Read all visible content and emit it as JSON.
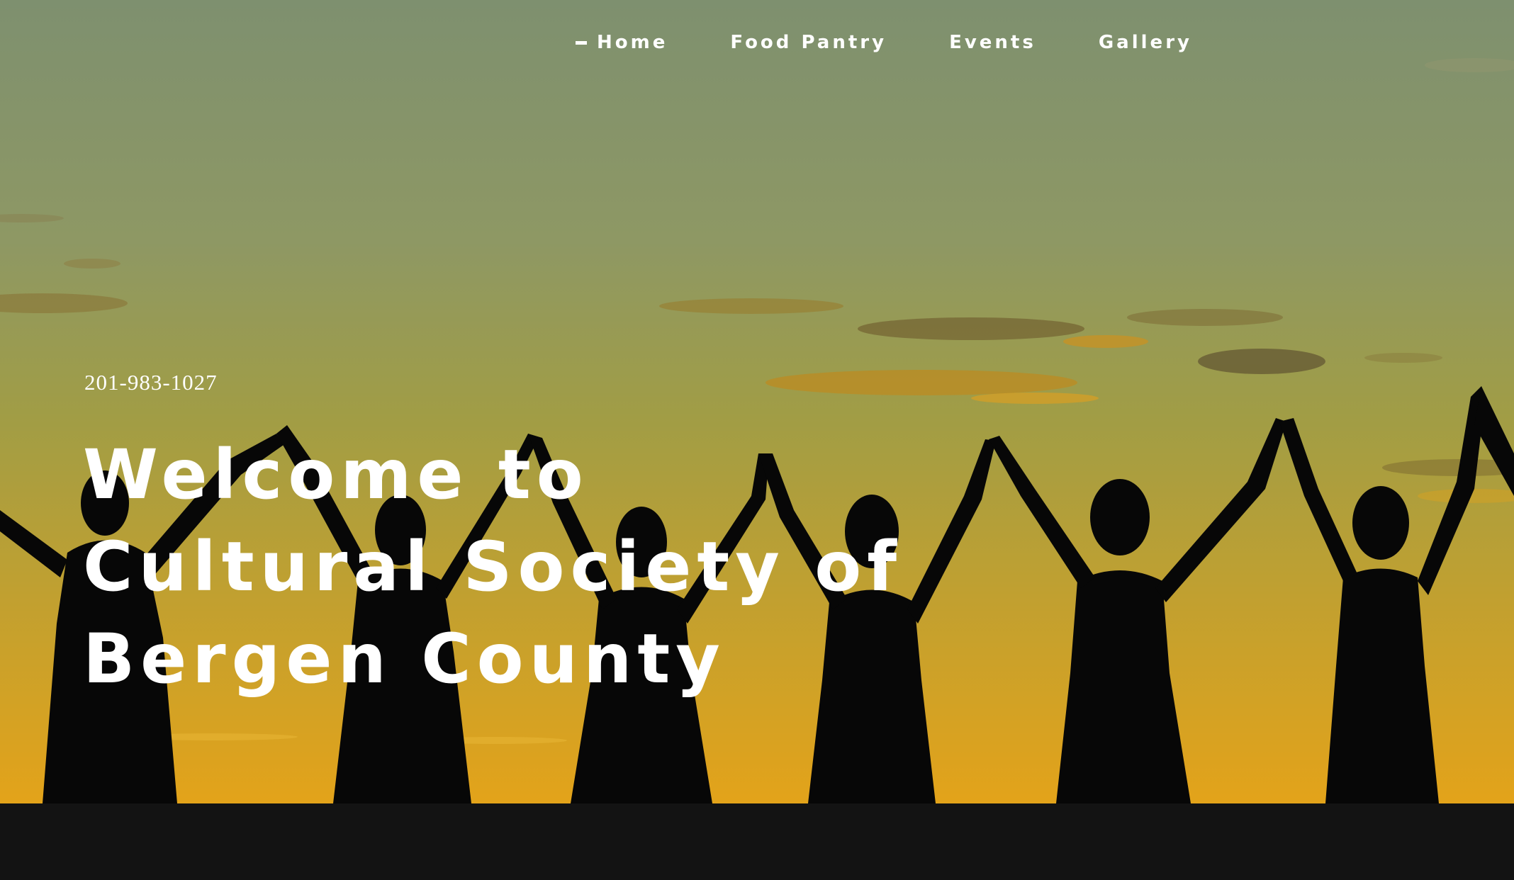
{
  "nav": {
    "items": [
      {
        "label": "Home",
        "active": true
      },
      {
        "label": "Food Pantry",
        "active": false
      },
      {
        "label": "Events",
        "active": false
      },
      {
        "label": "Gallery",
        "active": false
      }
    ]
  },
  "hero": {
    "phone": "201-983-1027",
    "title_lines": [
      "Welcome to",
      "Cultural Society of",
      "Bergen County"
    ]
  },
  "colors": {
    "sky_top": "#7f9070",
    "sky_bottom": "#e0a219",
    "silhouette": "#070707",
    "footer": "#131313",
    "text": "#ffffff"
  }
}
